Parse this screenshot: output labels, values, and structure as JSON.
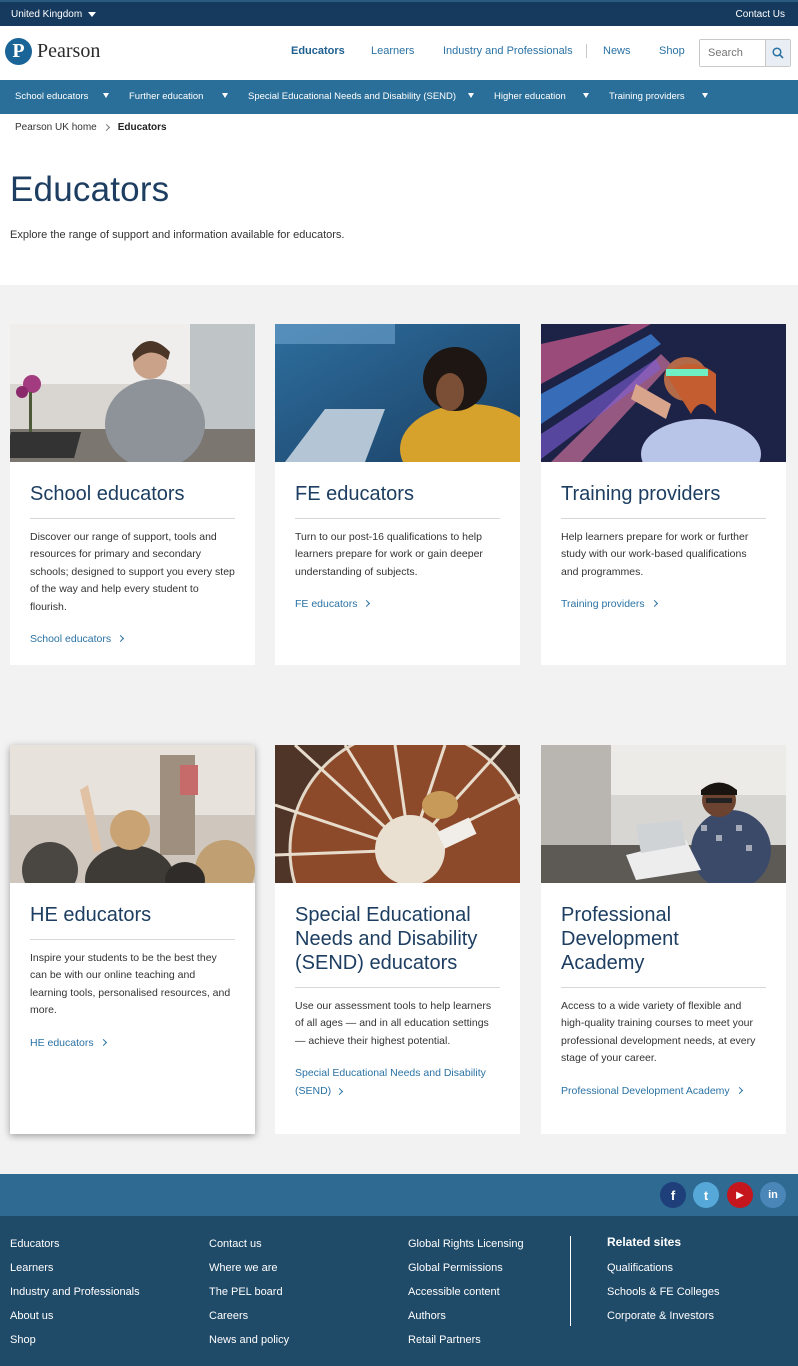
{
  "topbar": {
    "region": "United Kingdom",
    "contact": "Contact Us"
  },
  "header": {
    "logo_letter": "P",
    "logo_text": "Pearson",
    "nav": [
      "Educators",
      "Learners",
      "Industry and Professionals",
      "News",
      "Shop"
    ],
    "search_placeholder": "Search"
  },
  "subnav": [
    "School educators",
    "Further education",
    "Special Educational Needs and Disability (SEND)",
    "Higher education",
    "Training providers"
  ],
  "breadcrumb": {
    "home": "Pearson UK home",
    "current": "Educators"
  },
  "page": {
    "title": "Educators",
    "intro": "Explore the range of support and information available for educators."
  },
  "cards": [
    {
      "title": "School educators",
      "text": "Discover our range of support, tools and resources for primary and secondary schools; designed to support you every step of the way and help every student to flourish.",
      "link": "School educators"
    },
    {
      "title": "FE educators",
      "text": "Turn to our post-16 qualifications to help learners prepare for work or gain deeper understanding of subjects.",
      "link": "FE educators"
    },
    {
      "title": "Training providers",
      "text": "Help learners prepare for work or further study with our work-based qualifications and programmes.",
      "link": "Training providers"
    },
    {
      "title": "HE educators",
      "text": "Inspire your students to be the best they can be with our online teaching and learning tools, personalised resources, and more.",
      "link": "HE educators"
    },
    {
      "title": "Special Educational Needs and Disability (SEND) educators",
      "text": "Use our assessment tools to help learners of all ages — and in all education settings — achieve their highest potential.",
      "link": "Special Educational Needs and Disability (SEND)"
    },
    {
      "title": "Professional Development Academy",
      "text": "Access to a wide variety of flexible and high-quality training courses to meet your professional development needs, at every stage of your career.",
      "link": "Professional Development Academy"
    }
  ],
  "social": {
    "facebook": "f",
    "twitter": "t",
    "youtube": "▶",
    "linkedin": "in"
  },
  "footer": {
    "col1": [
      "Educators",
      "Learners",
      "Industry and Professionals",
      "About us",
      "Shop"
    ],
    "col2": [
      "Contact us",
      "Where we are",
      "The PEL board",
      "Careers",
      "News and policy"
    ],
    "col3": [
      "Global Rights Licensing",
      "Global Permissions",
      "Accessible content",
      "Authors",
      "Retail Partners"
    ],
    "related_heading": "Related sites",
    "related": [
      "Qualifications",
      "Schools & FE Colleges",
      "Corporate & Investors"
    ]
  },
  "colors": {
    "navy": "#163a5e",
    "subnav": "#2a6f99",
    "link": "#2a72a4",
    "footer": "#1f4a68",
    "social_bar": "#2e6a92",
    "heading": "#1d3e61"
  }
}
